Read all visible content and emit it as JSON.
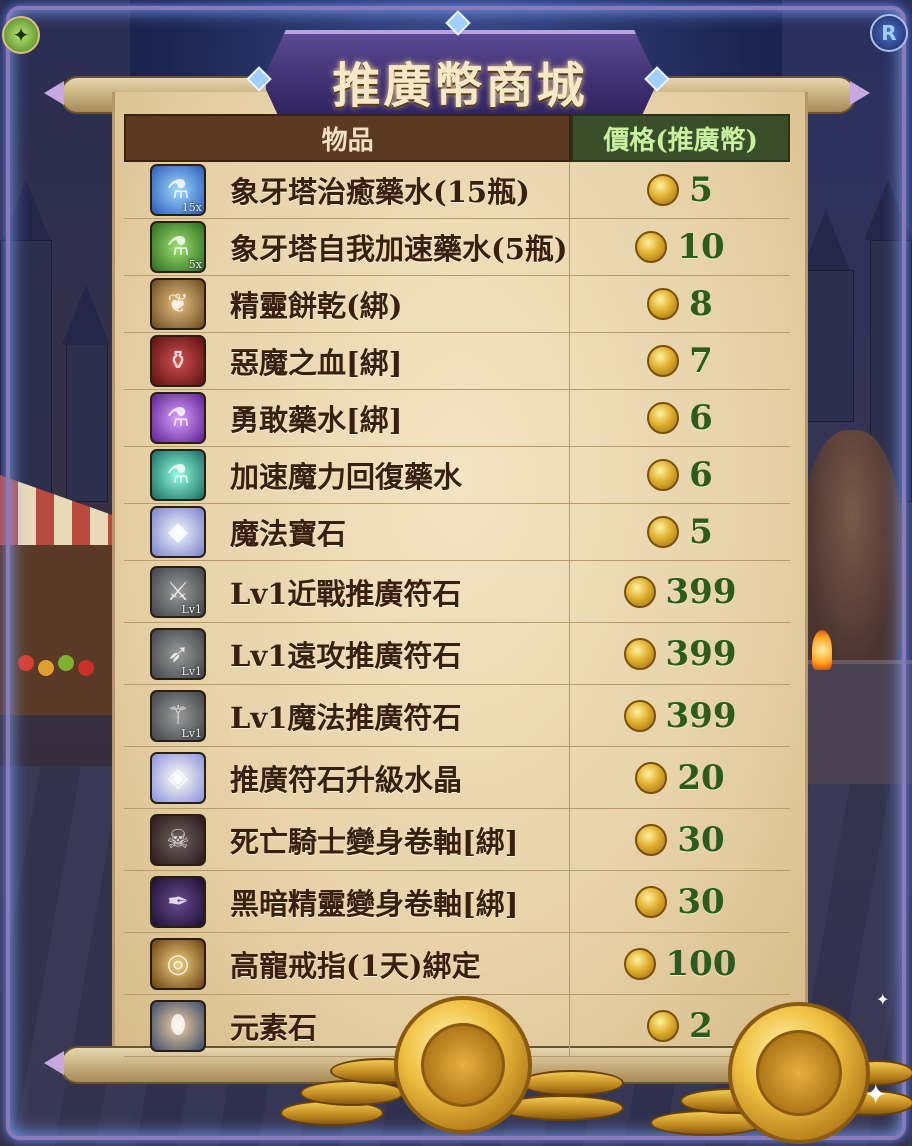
{
  "title": "推廣幣商城",
  "table": {
    "header_item": "物品",
    "header_price": "價格(推廣幣)"
  },
  "items": [
    {
      "name": "象牙塔治癒藥水(15瓶)",
      "price": "5",
      "icon": "blue-potion-icon",
      "badge": "15x"
    },
    {
      "name": "象牙塔自我加速藥水(5瓶)",
      "price": "10",
      "icon": "green-potion-icon",
      "badge": "5x"
    },
    {
      "name": "精靈餅乾(綁)",
      "price": "8",
      "icon": "elven-cookie-icon",
      "badge": ""
    },
    {
      "name": "惡魔之血[綁]",
      "price": "7",
      "icon": "demon-blood-icon",
      "badge": ""
    },
    {
      "name": "勇敢藥水[綁]",
      "price": "6",
      "icon": "purple-potion-icon",
      "badge": ""
    },
    {
      "name": "加速魔力回復藥水",
      "price": "6",
      "icon": "teal-potion-icon",
      "badge": ""
    },
    {
      "name": "魔法寶石",
      "price": "5",
      "icon": "magic-gem-icon",
      "badge": ""
    },
    {
      "name": "Lv1近戰推廣符石",
      "price": "399",
      "icon": "melee-rune-icon",
      "badge": "Lv1"
    },
    {
      "name": "Lv1遠攻推廣符石",
      "price": "399",
      "icon": "ranged-rune-icon",
      "badge": "Lv1"
    },
    {
      "name": "Lv1魔法推廣符石",
      "price": "399",
      "icon": "magic-rune-icon",
      "badge": "Lv1"
    },
    {
      "name": "推廣符石升級水晶",
      "price": "20",
      "icon": "upgrade-crystal-icon",
      "badge": ""
    },
    {
      "name": "死亡騎士變身卷軸[綁]",
      "price": "30",
      "icon": "death-knight-scroll-icon",
      "badge": ""
    },
    {
      "name": "黑暗精靈變身卷軸[綁]",
      "price": "30",
      "icon": "dark-elf-scroll-icon",
      "badge": ""
    },
    {
      "name": "高寵戒指(1天)綁定",
      "price": "100",
      "icon": "ring-icon",
      "badge": ""
    },
    {
      "name": "元素石",
      "price": "2",
      "icon": "element-stone-icon",
      "badge": ""
    }
  ],
  "corner_icons": {
    "top_left": "elf-emblem-icon",
    "top_right": "rune-r-icon",
    "top_right_glyph": "R"
  },
  "colors": {
    "banner": "#3d2f70",
    "parchment": "#e7d2a8",
    "header_item_bg": "#5c3a22",
    "header_price_bg": "#3a4e2a",
    "price_text": "#2d5a1e",
    "item_text": "#3a1f0e",
    "coin": "#e0b030"
  }
}
